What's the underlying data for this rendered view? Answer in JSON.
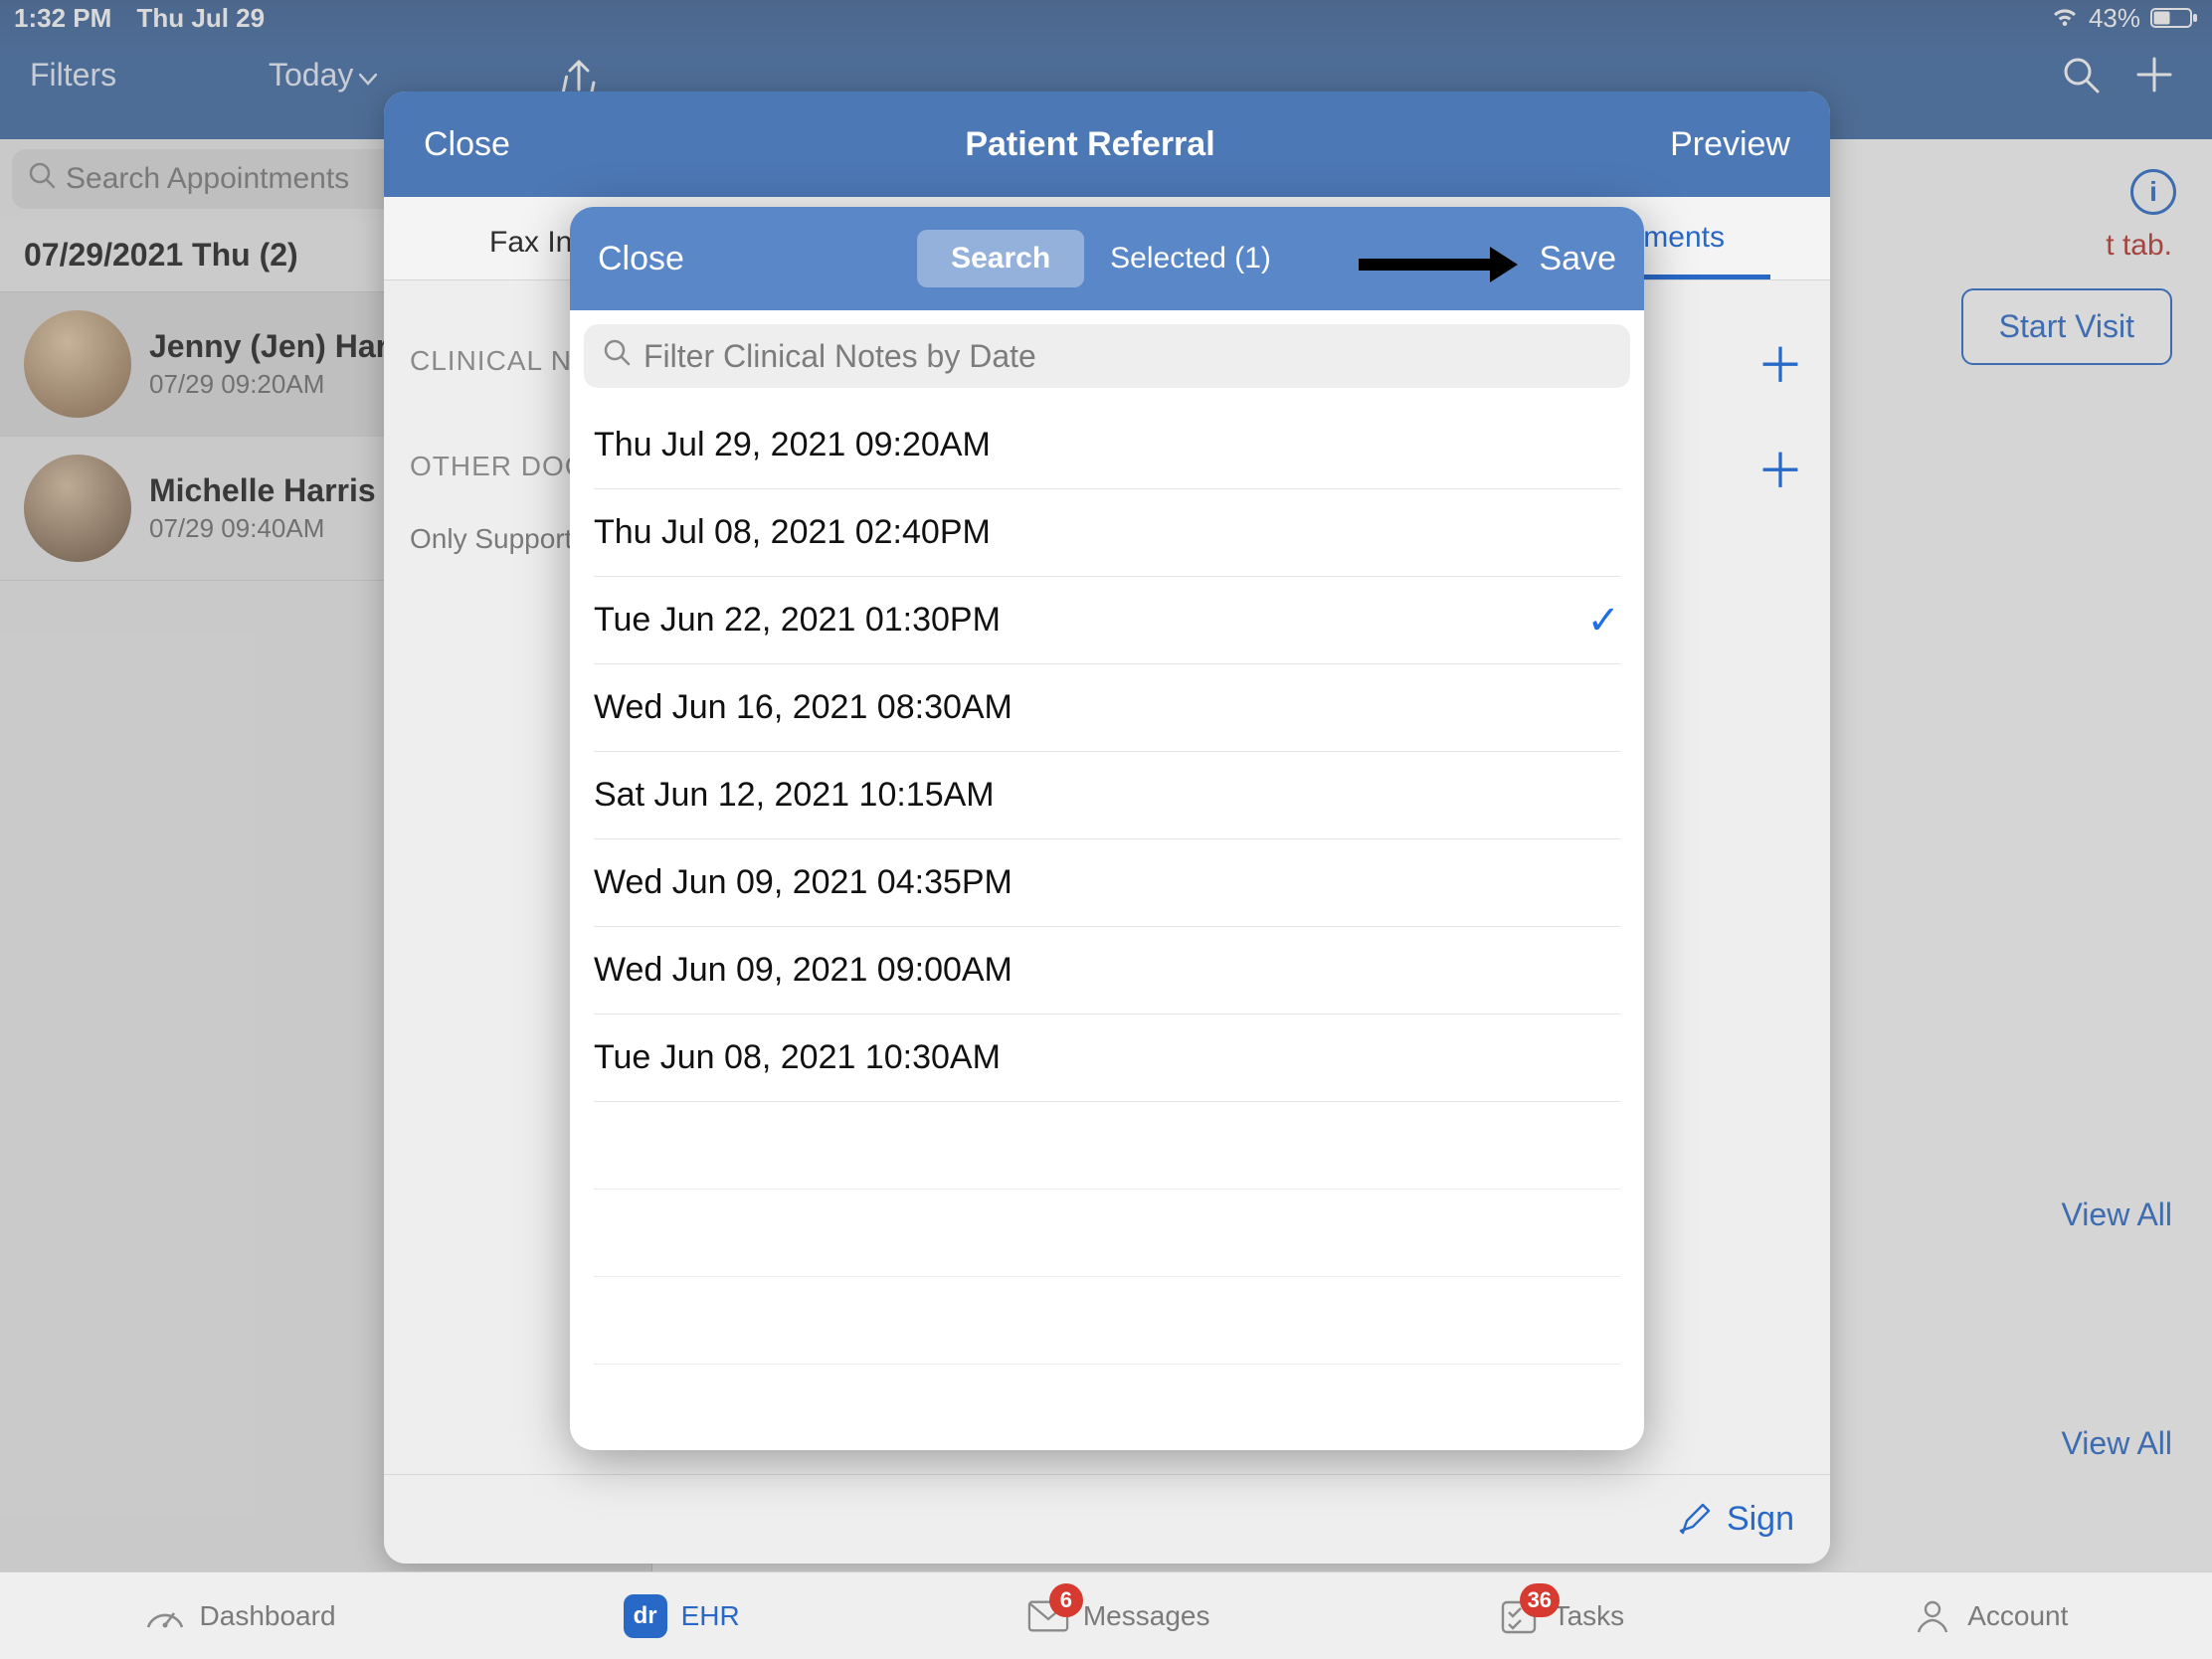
{
  "status": {
    "time": "1:32 PM",
    "date": "Thu Jul 29",
    "battery_pct": "43%"
  },
  "nav": {
    "filters": "Filters",
    "today": "Today"
  },
  "left": {
    "search_placeholder": "Search Appointments",
    "date_header": "07/29/2021 Thu (2)",
    "appointments": [
      {
        "name": "Jenny (Jen) Harris",
        "when": "07/29 09:20AM"
      },
      {
        "name": "Michelle Harris",
        "when": "07/29 09:40AM"
      }
    ]
  },
  "right": {
    "hint_fragment": "t tab.",
    "start_visit": "Start Visit",
    "view_all": "View All"
  },
  "modal1": {
    "close": "Close",
    "title": "Patient Referral",
    "preview": "Preview",
    "tab_fax": "Fax Info",
    "tab_documents": "Documents",
    "section_clinical": "CLINICAL NOTES",
    "section_other": "OTHER DOCUMENTS",
    "supports_note": "Only Supported file types",
    "sign": "Sign"
  },
  "modal2": {
    "close": "Close",
    "seg_search": "Search",
    "seg_selected": "Selected (1)",
    "save": "Save",
    "filter_placeholder": "Filter Clinical Notes by Date",
    "notes": [
      {
        "label": "Thu Jul 29, 2021 09:20AM",
        "selected": false
      },
      {
        "label": "Thu Jul 08, 2021 02:40PM",
        "selected": false
      },
      {
        "label": "Tue Jun 22, 2021 01:30PM",
        "selected": true
      },
      {
        "label": "Wed Jun 16, 2021 08:30AM",
        "selected": false
      },
      {
        "label": "Sat Jun 12, 2021 10:15AM",
        "selected": false
      },
      {
        "label": "Wed Jun 09, 2021 04:35PM",
        "selected": false
      },
      {
        "label": "Wed Jun 09, 2021 09:00AM",
        "selected": false
      },
      {
        "label": "Tue Jun 08, 2021 10:30AM",
        "selected": false
      }
    ]
  },
  "tabbar": {
    "dashboard": "Dashboard",
    "ehr": "EHR",
    "messages": "Messages",
    "messages_badge": "6",
    "tasks": "Tasks",
    "tasks_badge": "36",
    "account": "Account"
  }
}
